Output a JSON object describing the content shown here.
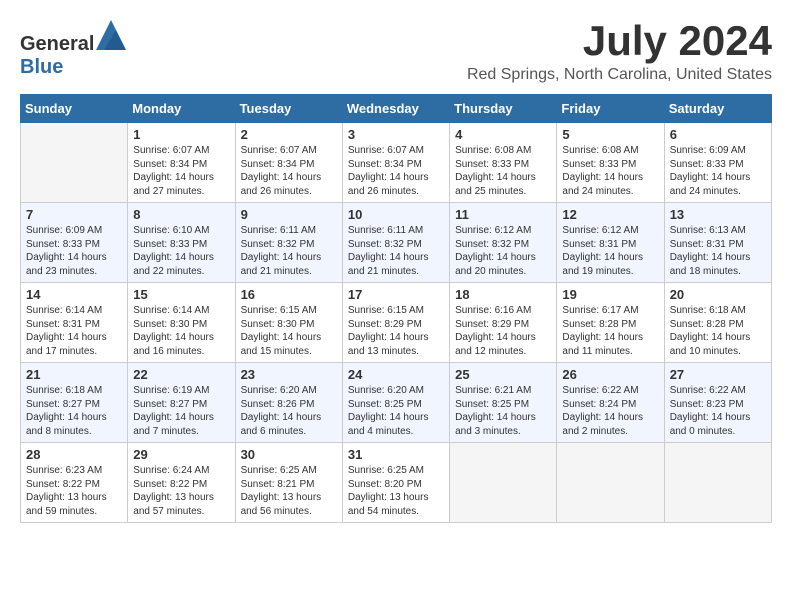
{
  "header": {
    "logo": {
      "text_general": "General",
      "text_blue": "Blue"
    },
    "title": "July 2024",
    "location": "Red Springs, North Carolina, United States"
  },
  "calendar": {
    "days_of_week": [
      "Sunday",
      "Monday",
      "Tuesday",
      "Wednesday",
      "Thursday",
      "Friday",
      "Saturday"
    ],
    "weeks": [
      [
        {
          "day": "",
          "info": ""
        },
        {
          "day": "1",
          "info": "Sunrise: 6:07 AM\nSunset: 8:34 PM\nDaylight: 14 hours\nand 27 minutes."
        },
        {
          "day": "2",
          "info": "Sunrise: 6:07 AM\nSunset: 8:34 PM\nDaylight: 14 hours\nand 26 minutes."
        },
        {
          "day": "3",
          "info": "Sunrise: 6:07 AM\nSunset: 8:34 PM\nDaylight: 14 hours\nand 26 minutes."
        },
        {
          "day": "4",
          "info": "Sunrise: 6:08 AM\nSunset: 8:33 PM\nDaylight: 14 hours\nand 25 minutes."
        },
        {
          "day": "5",
          "info": "Sunrise: 6:08 AM\nSunset: 8:33 PM\nDaylight: 14 hours\nand 24 minutes."
        },
        {
          "day": "6",
          "info": "Sunrise: 6:09 AM\nSunset: 8:33 PM\nDaylight: 14 hours\nand 24 minutes."
        }
      ],
      [
        {
          "day": "7",
          "info": "Sunrise: 6:09 AM\nSunset: 8:33 PM\nDaylight: 14 hours\nand 23 minutes."
        },
        {
          "day": "8",
          "info": "Sunrise: 6:10 AM\nSunset: 8:33 PM\nDaylight: 14 hours\nand 22 minutes."
        },
        {
          "day": "9",
          "info": "Sunrise: 6:11 AM\nSunset: 8:32 PM\nDaylight: 14 hours\nand 21 minutes."
        },
        {
          "day": "10",
          "info": "Sunrise: 6:11 AM\nSunset: 8:32 PM\nDaylight: 14 hours\nand 21 minutes."
        },
        {
          "day": "11",
          "info": "Sunrise: 6:12 AM\nSunset: 8:32 PM\nDaylight: 14 hours\nand 20 minutes."
        },
        {
          "day": "12",
          "info": "Sunrise: 6:12 AM\nSunset: 8:31 PM\nDaylight: 14 hours\nand 19 minutes."
        },
        {
          "day": "13",
          "info": "Sunrise: 6:13 AM\nSunset: 8:31 PM\nDaylight: 14 hours\nand 18 minutes."
        }
      ],
      [
        {
          "day": "14",
          "info": "Sunrise: 6:14 AM\nSunset: 8:31 PM\nDaylight: 14 hours\nand 17 minutes."
        },
        {
          "day": "15",
          "info": "Sunrise: 6:14 AM\nSunset: 8:30 PM\nDaylight: 14 hours\nand 16 minutes."
        },
        {
          "day": "16",
          "info": "Sunrise: 6:15 AM\nSunset: 8:30 PM\nDaylight: 14 hours\nand 15 minutes."
        },
        {
          "day": "17",
          "info": "Sunrise: 6:15 AM\nSunset: 8:29 PM\nDaylight: 14 hours\nand 13 minutes."
        },
        {
          "day": "18",
          "info": "Sunrise: 6:16 AM\nSunset: 8:29 PM\nDaylight: 14 hours\nand 12 minutes."
        },
        {
          "day": "19",
          "info": "Sunrise: 6:17 AM\nSunset: 8:28 PM\nDaylight: 14 hours\nand 11 minutes."
        },
        {
          "day": "20",
          "info": "Sunrise: 6:18 AM\nSunset: 8:28 PM\nDaylight: 14 hours\nand 10 minutes."
        }
      ],
      [
        {
          "day": "21",
          "info": "Sunrise: 6:18 AM\nSunset: 8:27 PM\nDaylight: 14 hours\nand 8 minutes."
        },
        {
          "day": "22",
          "info": "Sunrise: 6:19 AM\nSunset: 8:27 PM\nDaylight: 14 hours\nand 7 minutes."
        },
        {
          "day": "23",
          "info": "Sunrise: 6:20 AM\nSunset: 8:26 PM\nDaylight: 14 hours\nand 6 minutes."
        },
        {
          "day": "24",
          "info": "Sunrise: 6:20 AM\nSunset: 8:25 PM\nDaylight: 14 hours\nand 4 minutes."
        },
        {
          "day": "25",
          "info": "Sunrise: 6:21 AM\nSunset: 8:25 PM\nDaylight: 14 hours\nand 3 minutes."
        },
        {
          "day": "26",
          "info": "Sunrise: 6:22 AM\nSunset: 8:24 PM\nDaylight: 14 hours\nand 2 minutes."
        },
        {
          "day": "27",
          "info": "Sunrise: 6:22 AM\nSunset: 8:23 PM\nDaylight: 14 hours\nand 0 minutes."
        }
      ],
      [
        {
          "day": "28",
          "info": "Sunrise: 6:23 AM\nSunset: 8:22 PM\nDaylight: 13 hours\nand 59 minutes."
        },
        {
          "day": "29",
          "info": "Sunrise: 6:24 AM\nSunset: 8:22 PM\nDaylight: 13 hours\nand 57 minutes."
        },
        {
          "day": "30",
          "info": "Sunrise: 6:25 AM\nSunset: 8:21 PM\nDaylight: 13 hours\nand 56 minutes."
        },
        {
          "day": "31",
          "info": "Sunrise: 6:25 AM\nSunset: 8:20 PM\nDaylight: 13 hours\nand 54 minutes."
        },
        {
          "day": "",
          "info": ""
        },
        {
          "day": "",
          "info": ""
        },
        {
          "day": "",
          "info": ""
        }
      ]
    ]
  }
}
